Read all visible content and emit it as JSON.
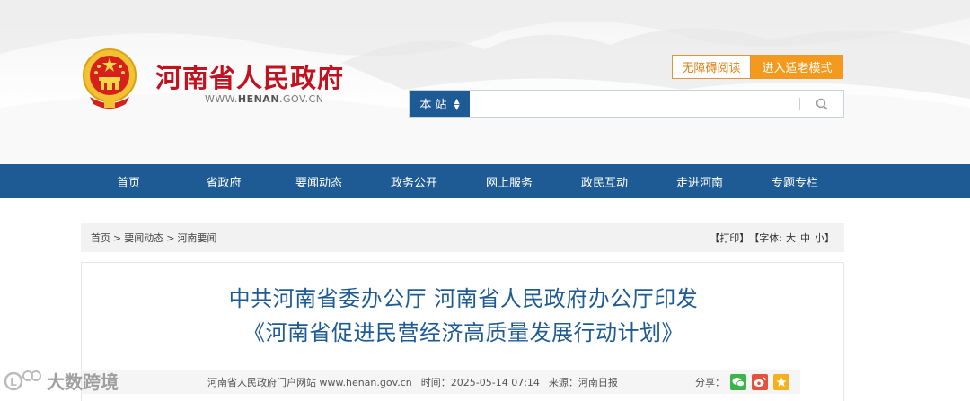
{
  "site": {
    "title": "河南省人民政府",
    "url_prefix": "WWW.",
    "url_brand": "HENAN",
    "url_suffix": ".GOV.CN"
  },
  "header_buttons": {
    "accessible": "无障碍阅读",
    "elder_mode": "进入适老模式"
  },
  "search": {
    "scope": "本 站",
    "placeholder": "",
    "icon": "search-icon"
  },
  "nav": {
    "items": [
      "首页",
      "省政府",
      "要闻动态",
      "政务公开",
      "网上服务",
      "政民互动",
      "走进河南",
      "专题专栏"
    ]
  },
  "breadcrumb": {
    "items": [
      "首页",
      "要闻动态",
      "河南要闻"
    ],
    "separator": ">"
  },
  "tools": {
    "print": "【打印】",
    "font_label": "【字体: ",
    "font_large": "大",
    "font_medium": "中",
    "font_small": "小",
    "font_close": " 】"
  },
  "article": {
    "title_line1": "中共河南省委办公厅 河南省人民政府办公厅印发",
    "title_line2": "《河南省促进民营经济高质量发展行动计划》",
    "source": "河南省人民政府门户网站 www.henan.gov.cn",
    "time": "时间：2025-05-14 07:14",
    "origin": "来源：河南日报",
    "share_label": "分享："
  },
  "share_icons": [
    "wechat-icon",
    "weibo-icon",
    "qzone-icon"
  ],
  "watermark": "大数跨境",
  "colors": {
    "brand_blue": "#1e5b94",
    "title_red": "#c1121f",
    "orange": "#f39a1e"
  }
}
